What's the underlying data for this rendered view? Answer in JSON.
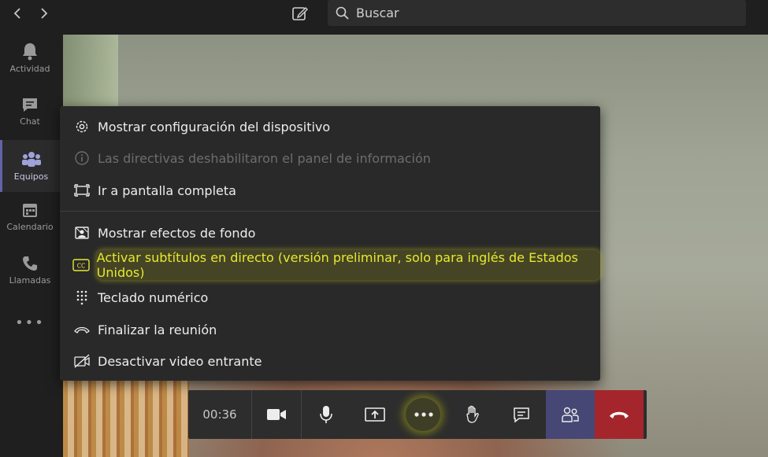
{
  "header": {
    "search_placeholder": "Buscar"
  },
  "rail": {
    "items": [
      {
        "label": "Actividad",
        "icon": "bell-icon"
      },
      {
        "label": "Chat",
        "icon": "chat-icon"
      },
      {
        "label": "Equipos",
        "icon": "teams-icon",
        "active": true
      },
      {
        "label": "Calendario",
        "icon": "calendar-icon"
      },
      {
        "label": "Llamadas",
        "icon": "phone-icon"
      }
    ],
    "more": "•••"
  },
  "menu": {
    "items": [
      {
        "label": "Mostrar configuración del dispositivo",
        "icon": "gear-icon"
      },
      {
        "label": "Las directivas deshabilitaron el panel de información",
        "icon": "info-icon",
        "disabled": true
      },
      {
        "label": "Ir a pantalla completa",
        "icon": "fullscreen-icon"
      },
      {
        "label": "Mostrar efectos de fondo",
        "icon": "background-effects-icon"
      },
      {
        "label": "Activar subtítulos en directo (versión preliminar, solo para inglés de Estados Unidos)",
        "icon": "cc-icon",
        "highlighted": true
      },
      {
        "label": "Teclado numérico",
        "icon": "dialpad-icon"
      },
      {
        "label": "Finalizar la reunión",
        "icon": "hangup-icon"
      },
      {
        "label": "Desactivar video entrante",
        "icon": "video-off-icon"
      }
    ]
  },
  "controls": {
    "timer": "00:36"
  },
  "colors": {
    "accent": "#6264a7",
    "hangup": "#a4262c",
    "highlight": "#e8e830"
  }
}
